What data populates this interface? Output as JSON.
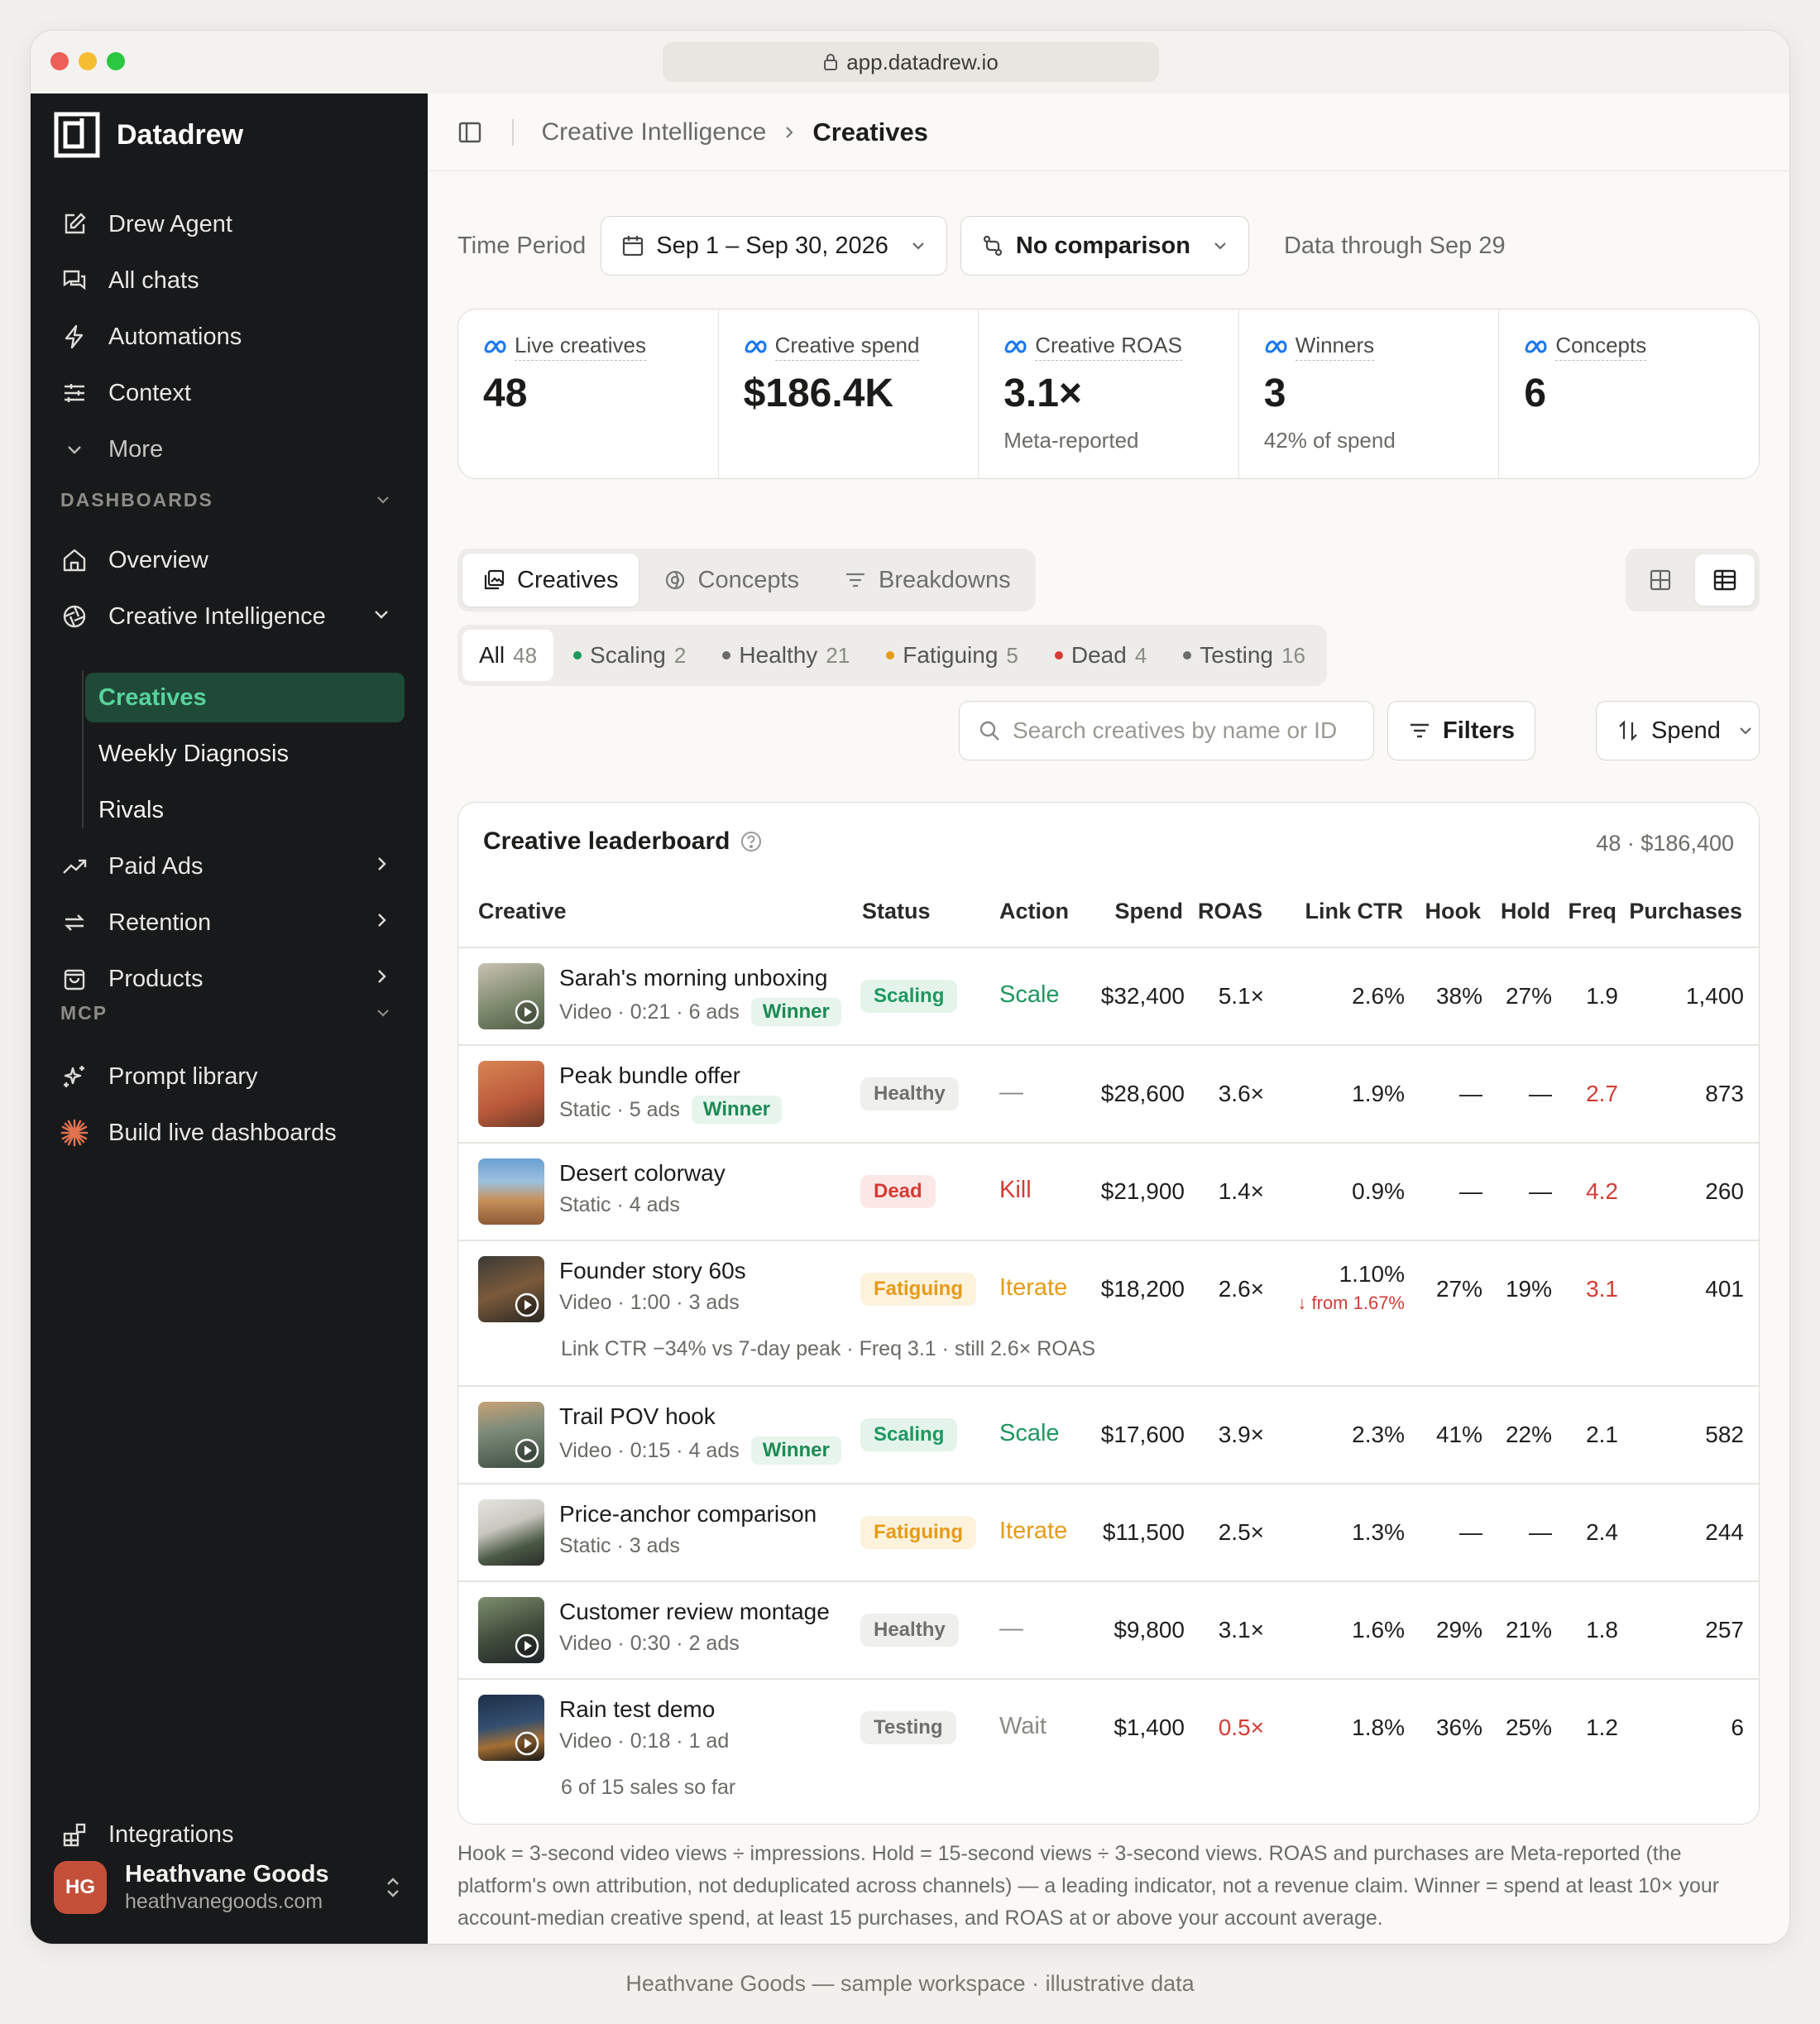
{
  "browser": {
    "url": "app.datadrew.io"
  },
  "sidebar": {
    "brand": "Datadrew",
    "top_items": [
      {
        "label": "Drew Agent",
        "icon": "edit-icon"
      },
      {
        "label": "All chats",
        "icon": "chats-icon"
      },
      {
        "label": "Automations",
        "icon": "bolt-icon"
      },
      {
        "label": "Context",
        "icon": "sliders-icon"
      },
      {
        "label": "More",
        "icon": "chevron-down-icon"
      }
    ],
    "dashboards_label": "DASHBOARDS",
    "overview": "Overview",
    "creative_intelligence": "Creative Intelligence",
    "sub_items": [
      "Creatives",
      "Weekly Diagnosis",
      "Rivals"
    ],
    "paid_ads": "Paid Ads",
    "retention": "Retention",
    "products": "Products",
    "mcp_label": "MCP",
    "prompt_library": "Prompt library",
    "build_dashboards": "Build live dashboards",
    "integrations": "Integrations",
    "account": {
      "initials": "HG",
      "name": "Heathvane Goods",
      "domain": "heathvanegoods.com"
    }
  },
  "breadcrumb": {
    "parent": "Creative Intelligence",
    "current": "Creatives"
  },
  "filters": {
    "time_label": "Time Period",
    "date_range": "Sep 1 – Sep 30, 2026",
    "comparison": "No comparison",
    "data_through": "Data through Sep 29"
  },
  "kpis": [
    {
      "label": "Live creatives",
      "value": "48",
      "sub": ""
    },
    {
      "label": "Creative spend",
      "value": "$186.4K",
      "sub": ""
    },
    {
      "label": "Creative ROAS",
      "value": "3.1×",
      "sub": "Meta-reported"
    },
    {
      "label": "Winners",
      "value": "3",
      "sub": "42% of spend"
    },
    {
      "label": "Concepts",
      "value": "6",
      "sub": ""
    }
  ],
  "tabs": [
    "Creatives",
    "Concepts",
    "Breakdowns"
  ],
  "status_chips": [
    {
      "label": "All",
      "count": "48",
      "color": ""
    },
    {
      "label": "Scaling",
      "count": "2",
      "color": "#1f9760"
    },
    {
      "label": "Healthy",
      "count": "21",
      "color": "#6b6b67"
    },
    {
      "label": "Fatiguing",
      "count": "5",
      "color": "#e69b16"
    },
    {
      "label": "Dead",
      "count": "4",
      "color": "#d33c34"
    },
    {
      "label": "Testing",
      "count": "16",
      "color": "#6b6b67"
    }
  ],
  "search": {
    "placeholder": "Search creatives by name or ID"
  },
  "filters_button": "Filters",
  "sort_button": "Spend",
  "leaderboard": {
    "title": "Creative leaderboard",
    "count": "48 · $186,400",
    "columns": [
      "Creative",
      "Status",
      "Action",
      "Spend",
      "ROAS",
      "Link CTR",
      "Hook",
      "Hold",
      "Freq",
      "Purchases"
    ],
    "rows": [
      {
        "name": "Sarah's morning unboxing",
        "meta": "Video · 0:21 · 6 ads",
        "winner": "Winner",
        "status": "Scaling",
        "action": "Scale",
        "spend": "$32,400",
        "roas": "5.1×",
        "ctr": "2.6%",
        "hook": "38%",
        "hold": "27%",
        "freq": "1.9",
        "purchases": "1,400"
      },
      {
        "name": "Peak bundle offer",
        "meta": "Static · 5 ads",
        "winner": "Winner",
        "status": "Healthy",
        "action": "—",
        "spend": "$28,600",
        "roas": "3.6×",
        "ctr": "1.9%",
        "hook": "—",
        "hold": "—",
        "freq": "2.7",
        "purchases": "873"
      },
      {
        "name": "Desert colorway",
        "meta": "Static · 4 ads",
        "winner": "",
        "status": "Dead",
        "action": "Kill",
        "spend": "$21,900",
        "roas": "1.4×",
        "ctr": "0.9%",
        "hook": "—",
        "hold": "—",
        "freq": "4.2",
        "purchases": "260"
      },
      {
        "name": "Founder story 60s",
        "meta": "Video · 1:00 · 3 ads",
        "winner": "",
        "status": "Fatiguing",
        "action": "Iterate",
        "spend": "$18,200",
        "roas": "2.6×",
        "ctr": "1.10%",
        "ctr_sub": "↓ from 1.67%",
        "hook": "27%",
        "hold": "19%",
        "freq": "3.1",
        "purchases": "401",
        "note": "Link CTR −34% vs 7-day peak · Freq 3.1 · still 2.6× ROAS"
      },
      {
        "name": "Trail POV hook",
        "meta": "Video · 0:15 · 4 ads",
        "winner": "Winner",
        "status": "Scaling",
        "action": "Scale",
        "spend": "$17,600",
        "roas": "3.9×",
        "ctr": "2.3%",
        "hook": "41%",
        "hold": "22%",
        "freq": "2.1",
        "purchases": "582"
      },
      {
        "name": "Price-anchor comparison",
        "meta": "Static · 3 ads",
        "winner": "",
        "status": "Fatiguing",
        "action": "Iterate",
        "spend": "$11,500",
        "roas": "2.5×",
        "ctr": "1.3%",
        "hook": "—",
        "hold": "—",
        "freq": "2.4",
        "purchases": "244"
      },
      {
        "name": "Customer review montage",
        "meta": "Video · 0:30 · 2 ads",
        "winner": "",
        "status": "Healthy",
        "action": "—",
        "spend": "$9,800",
        "roas": "3.1×",
        "ctr": "1.6%",
        "hook": "29%",
        "hold": "21%",
        "freq": "1.8",
        "purchases": "257"
      },
      {
        "name": "Rain test demo",
        "meta": "Video · 0:18 · 1 ad",
        "winner": "",
        "status": "Testing",
        "action": "Wait",
        "spend": "$1,400",
        "roas": "0.5×",
        "ctr": "1.8%",
        "hook": "36%",
        "hold": "25%",
        "freq": "1.2",
        "purchases": "6",
        "note": "6 of 15 sales so far"
      }
    ]
  },
  "footnote": "Hook = 3-second video views ÷ impressions. Hold = 15-second views ÷ 3-second views. ROAS and purchases are Meta-reported (the platform's own attribution, not deduplicated across channels) — a leading indicator, not a revenue claim. Winner = spend at least 10× your account-median creative spend, at least 15 purchases, and ROAS at or above your account average.",
  "page_footer": "Heathvane Goods — sample workspace · illustrative data"
}
